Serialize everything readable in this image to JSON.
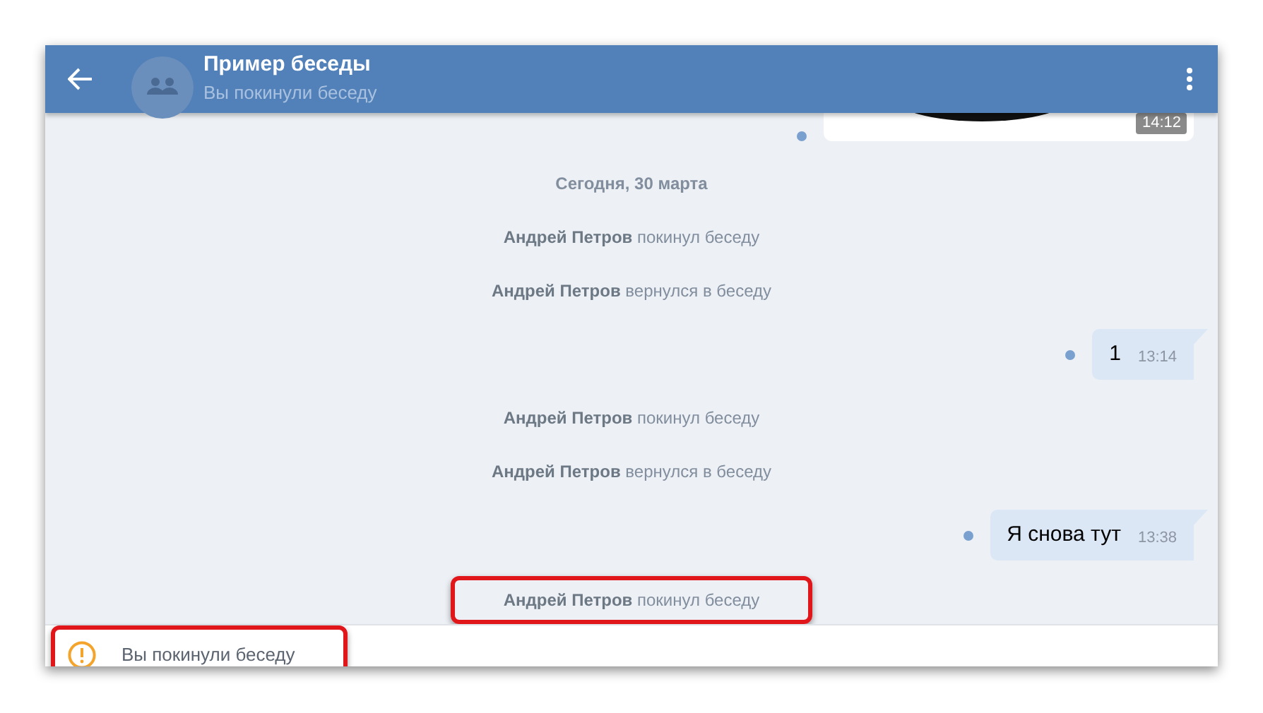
{
  "header": {
    "title": "Пример беседы",
    "subtitle": "Вы покинули беседу"
  },
  "messages": [
    {
      "time": "14:12",
      "unread": true,
      "highlighted": false
    },
    {
      "kind": "date",
      "text": "Сегодня, 30 марта",
      "highlighted": false
    },
    {
      "kind": "service",
      "text": "**Андрей Петров** покинул беседу",
      "highlighted": false
    },
    {
      "kind": "service",
      "text": "**Андрей Петров** вернулся в беседу",
      "highlighted": false
    },
    {
      "kind": "outgoing",
      "text": "1",
      "time": "13:14",
      "unread": true,
      "highlighted": false
    },
    {
      "kind": "service",
      "text": "**Андрей Петров** покинул беседу",
      "highlighted": false
    },
    {
      "kind": "service",
      "text": "**Андрей Петров** вернулся в беседу",
      "highlighted": false
    },
    {
      "kind": "outgoing",
      "text": "Я снова тут",
      "time": "13:38",
      "unread": true,
      "highlighted": false
    },
    {
      "kind": "service",
      "text": "**Андрей Петров** покинул беседу",
      "highlighted": true
    }
  ],
  "notice": {
    "text": "Вы покинули беседу",
    "highlighted": true
  }
}
